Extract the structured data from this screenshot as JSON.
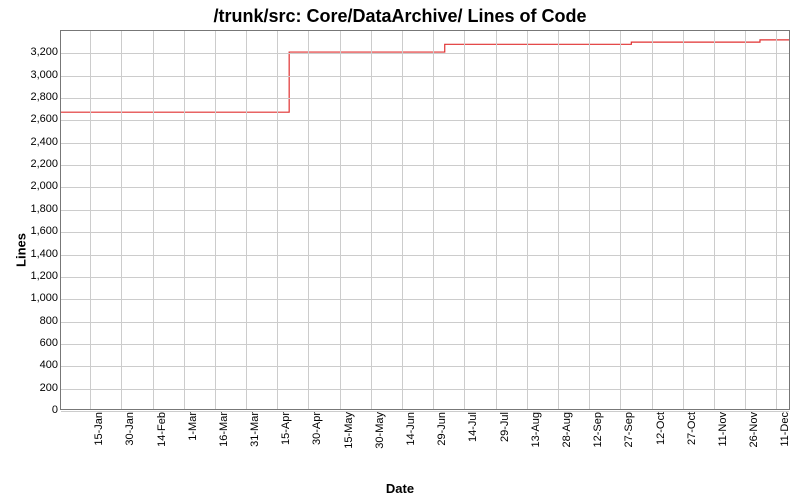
{
  "chart_data": {
    "type": "line",
    "title": "/trunk/src: Core/DataArchive/ Lines of Code",
    "xlabel": "Date",
    "ylabel": "Lines",
    "ylim": [
      0,
      3400
    ],
    "y_ticks": [
      0,
      200,
      400,
      600,
      800,
      1000,
      1200,
      1400,
      1600,
      1800,
      2000,
      2200,
      2400,
      2600,
      2800,
      3000,
      3200
    ],
    "x_categories": [
      "15-Jan",
      "30-Jan",
      "14-Feb",
      "1-Mar",
      "16-Mar",
      "31-Mar",
      "15-Apr",
      "30-Apr",
      "15-May",
      "30-May",
      "14-Jun",
      "29-Jun",
      "14-Jul",
      "29-Jul",
      "13-Aug",
      "28-Aug",
      "12-Sep",
      "27-Sep",
      "12-Oct",
      "27-Oct",
      "11-Nov",
      "26-Nov",
      "11-Dec"
    ],
    "series": [
      {
        "name": "Lines of Code",
        "color": "#e03030",
        "points": [
          {
            "x": "1-Jan",
            "y": 2670
          },
          {
            "x": "21-Apr",
            "y": 2670
          },
          {
            "x": "21-Apr",
            "y": 3210
          },
          {
            "x": "5-Jul",
            "y": 3210
          },
          {
            "x": "5-Jul",
            "y": 3280
          },
          {
            "x": "3-Oct",
            "y": 3280
          },
          {
            "x": "3-Oct",
            "y": 3300
          },
          {
            "x": "4-Dec",
            "y": 3300
          },
          {
            "x": "4-Dec",
            "y": 3320
          },
          {
            "x": "18-Dec",
            "y": 3320
          }
        ]
      }
    ]
  }
}
